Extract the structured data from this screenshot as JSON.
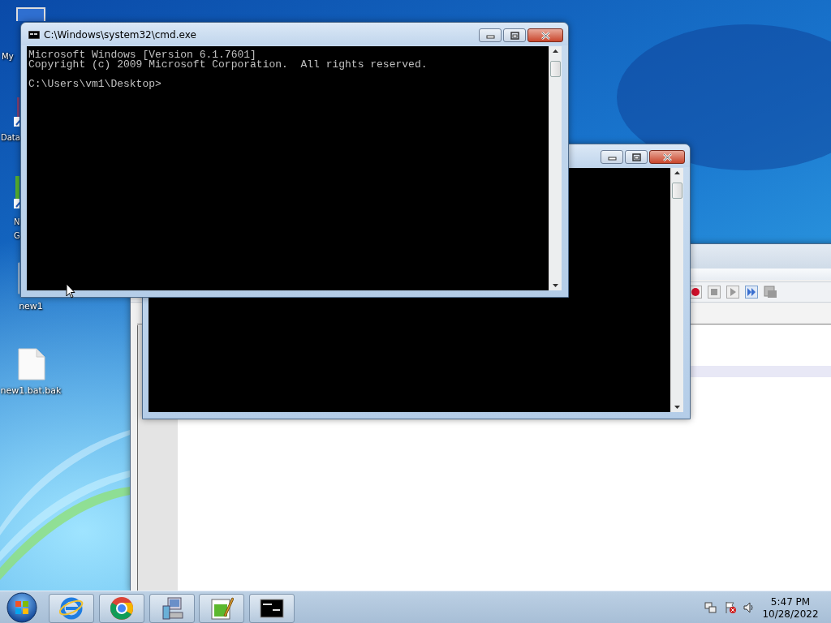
{
  "desktop_icons": [
    {
      "kind": "computer",
      "lines": [
        "My"
      ]
    },
    {
      "kind": "shortcut",
      "lines": [
        "Data"
      ]
    },
    {
      "kind": "app",
      "lines": [
        "N",
        "G"
      ]
    },
    {
      "kind": "file",
      "lines": [
        "new1"
      ]
    },
    {
      "kind": "file",
      "lines": [
        "new1.bat.bak"
      ]
    }
  ],
  "editor_window": {
    "toolbar": [
      {
        "kind": "record"
      },
      {
        "kind": "stop"
      },
      {
        "kind": "play"
      },
      {
        "kind": "fast-forward"
      },
      {
        "kind": "macro-list"
      }
    ]
  },
  "console_back": {
    "buttons": [
      {
        "kind": "minimize"
      },
      {
        "kind": "maximize"
      },
      {
        "kind": "close"
      }
    ]
  },
  "console_front": {
    "title": "C:\\Windows\\system32\\cmd.exe",
    "output": "Microsoft Windows [Version 6.1.7601]\nCopyright (c) 2009 Microsoft Corporation.  All rights reserved.\n\nC:\\Users\\vm1\\Desktop>",
    "buttons": [
      {
        "kind": "minimize"
      },
      {
        "kind": "maximize"
      },
      {
        "kind": "close"
      }
    ]
  },
  "taskbar": {
    "buttons": [
      {
        "kind": "ie"
      },
      {
        "kind": "chrome"
      },
      {
        "kind": "tool"
      },
      {
        "kind": "editor"
      },
      {
        "kind": "console"
      }
    ]
  },
  "tray": {
    "icons": [
      {
        "kind": "network"
      },
      {
        "kind": "flag"
      },
      {
        "kind": "speaker"
      }
    ]
  },
  "clock": {
    "time": "5:47 PM",
    "date": "10/28/2022"
  }
}
